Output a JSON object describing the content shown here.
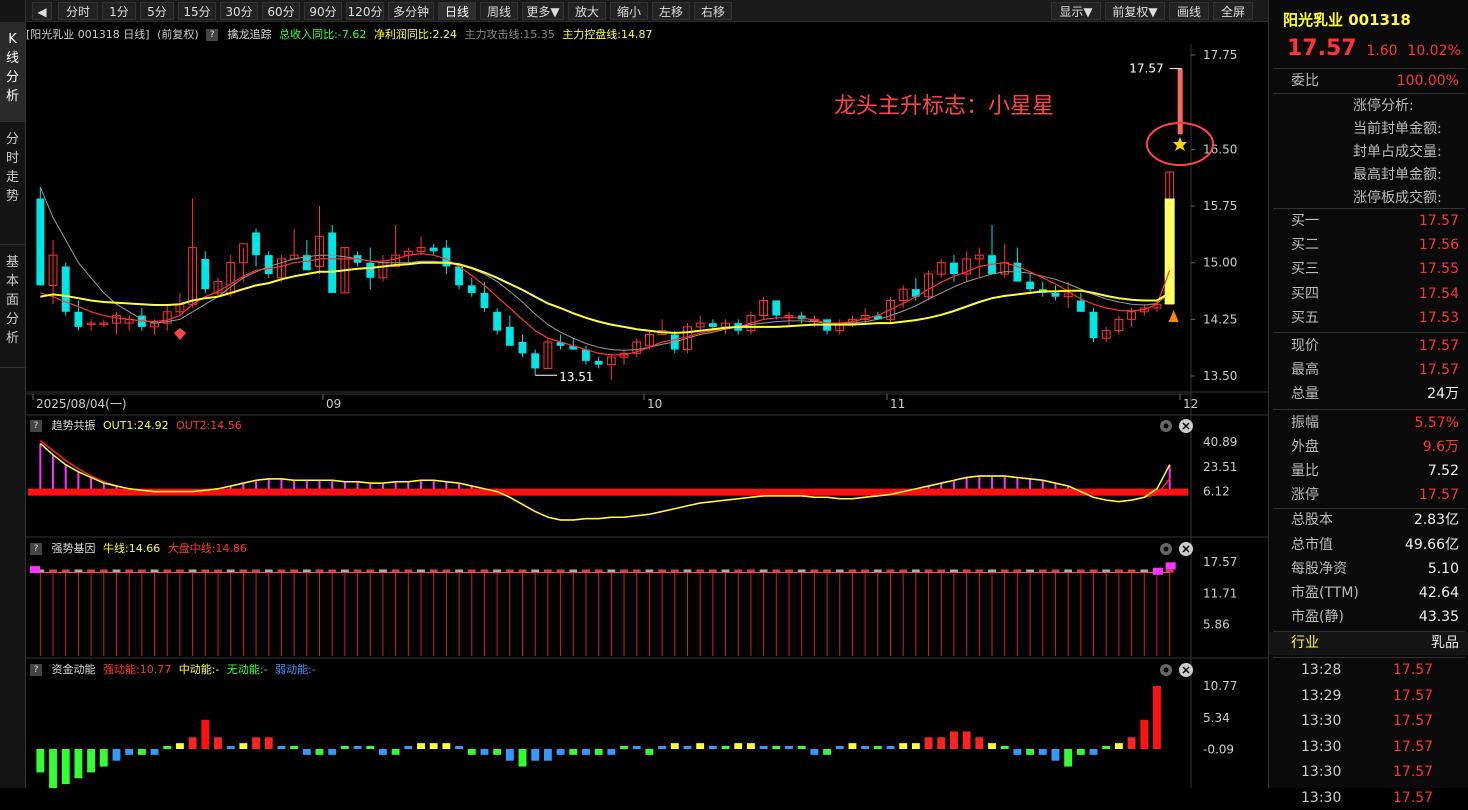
{
  "toolbar": {
    "items": [
      "分时",
      "1分",
      "5分",
      "15分",
      "30分",
      "60分",
      "90分",
      "120分",
      "多分钟",
      "日线",
      "周线",
      "更多▼",
      "放大",
      "缩小",
      "左移",
      "右移"
    ],
    "active": "日线",
    "right": [
      "显示▼",
      "前复权▼",
      "画线",
      "全屏"
    ]
  },
  "leftnav": [
    {
      "label": [
        "K",
        "线",
        "分",
        "析"
      ],
      "active": true
    },
    {
      "label": [
        "分",
        "时",
        "走",
        "势"
      ],
      "active": false
    },
    {
      "label": [
        "基",
        "本",
        "面",
        "分",
        "析"
      ],
      "active": false
    }
  ],
  "main_panel": {
    "stock": "[阳光乳业 001318 日线]",
    "adj": "(前复权)",
    "indicator": "擒龙追踪",
    "f1": "总收入同比:-7.62",
    "f2": "净利润同比:2.24",
    "f3": "主力攻击线:15.35",
    "f4": "主力控盘线:14.87",
    "annotation": "龙头主升标志：小星星",
    "high_label": "17.57",
    "low_label": "13.51",
    "yticks": [
      "17.75",
      "16.50",
      "15.75",
      "15.00",
      "14.25",
      "13.50"
    ],
    "xticks": [
      "2025/08/04(一)",
      "09",
      "10",
      "11",
      "12"
    ]
  },
  "panel2": {
    "name": "趋势共振",
    "l1": "OUT1:24.92",
    "l2": "OUT2:14.56",
    "yticks": [
      "40.89",
      "23.51",
      "6.12"
    ]
  },
  "panel3": {
    "name": "强势基因",
    "l1": "牛线:14.66",
    "l2": "大盘中线:14.86",
    "yticks": [
      "17.57",
      "11.71",
      "5.86"
    ]
  },
  "panel4": {
    "name": "资金动能",
    "l1": "强动能:10.77",
    "l2": "中动能:-",
    "l3": "无动能:-",
    "l4": "弱动能:-",
    "yticks": [
      "10.77",
      "5.34",
      "-0.09"
    ]
  },
  "quote": {
    "name": "阳光乳业",
    "code": "001318",
    "price": "17.57",
    "change": "1.60",
    "pct": "10.02%",
    "weibi_label": "委比",
    "weibi": "100.00%",
    "limit_title": "涨停分析:",
    "limit_rows": [
      "当前封单金额:",
      "封单占成交量:",
      "最高封单金额:",
      "涨停板成交额:"
    ],
    "buy": [
      {
        "k": "买一",
        "v": "17.57"
      },
      {
        "k": "买二",
        "v": "17.56"
      },
      {
        "k": "买三",
        "v": "17.55"
      },
      {
        "k": "买四",
        "v": "17.54"
      },
      {
        "k": "买五",
        "v": "17.53"
      }
    ],
    "stats1": [
      {
        "k": "现价",
        "v": "17.57",
        "c": "red"
      },
      {
        "k": "最高",
        "v": "17.57",
        "c": "red"
      },
      {
        "k": "总量",
        "v": "24万",
        "c": "white"
      }
    ],
    "stats2": [
      {
        "k": "振幅",
        "v": "5.57%",
        "c": "red"
      },
      {
        "k": "外盘",
        "v": "9.6万",
        "c": "red"
      },
      {
        "k": "量比",
        "v": "7.52",
        "c": "white"
      },
      {
        "k": "涨停",
        "v": "17.57",
        "c": "red"
      }
    ],
    "stats3": [
      {
        "k": "总股本",
        "v": "2.83亿"
      },
      {
        "k": "总市值",
        "v": "49.66亿"
      },
      {
        "k": "每股净资",
        "v": "5.10"
      },
      {
        "k": "市盈(TTM)",
        "v": "42.64"
      },
      {
        "k": "市盈(静)",
        "v": "43.35"
      }
    ],
    "industry_label": "行业",
    "industry": "乳品",
    "ticks": [
      {
        "t": "13:28",
        "p": "17.57"
      },
      {
        "t": "13:29",
        "p": "17.57"
      },
      {
        "t": "13:30",
        "p": "17.57"
      },
      {
        "t": "13:30",
        "p": "17.57"
      },
      {
        "t": "13:30",
        "p": "17.57"
      },
      {
        "t": "13:30",
        "p": "17.57"
      }
    ]
  },
  "colors": {
    "up": "#ff3333",
    "down": "#00e5e5",
    "ma1": "#ffff33",
    "ma2": "#ff3333",
    "ma3": "#999999",
    "magenta": "#ff33ff",
    "blue": "#3399ff",
    "green": "#33ff33"
  },
  "chart_data": {
    "type": "candlestick",
    "ohlc": [
      [
        15.85,
        16.0,
        14.7,
        14.7
      ],
      [
        14.7,
        15.3,
        14.45,
        15.1
      ],
      [
        14.95,
        15.0,
        14.3,
        14.35
      ],
      [
        14.35,
        14.5,
        14.1,
        14.15
      ],
      [
        14.2,
        14.25,
        14.1,
        14.2
      ],
      [
        14.2,
        14.25,
        14.15,
        14.2
      ],
      [
        14.2,
        14.35,
        14.05,
        14.3
      ],
      [
        14.2,
        14.3,
        14.1,
        14.25
      ],
      [
        14.3,
        14.4,
        14.1,
        14.15
      ],
      [
        14.15,
        14.25,
        14.05,
        14.2
      ],
      [
        14.2,
        14.45,
        14.1,
        14.35
      ],
      [
        14.35,
        14.6,
        14.3,
        14.45
      ],
      [
        14.45,
        15.85,
        14.4,
        15.2
      ],
      [
        15.05,
        15.15,
        14.6,
        14.65
      ],
      [
        14.6,
        14.8,
        14.55,
        14.75
      ],
      [
        14.6,
        15.1,
        14.55,
        15.0
      ],
      [
        15.0,
        15.2,
        14.75,
        15.25
      ],
      [
        15.4,
        15.45,
        14.95,
        15.1
      ],
      [
        15.1,
        15.15,
        14.8,
        14.85
      ],
      [
        14.8,
        15.1,
        14.75,
        15.05
      ],
      [
        15.05,
        15.45,
        15.05,
        15.1
      ],
      [
        15.1,
        15.3,
        14.9,
        14.9
      ],
      [
        14.95,
        15.75,
        14.85,
        15.35
      ],
      [
        15.4,
        15.5,
        14.8,
        14.6
      ],
      [
        14.6,
        15.2,
        14.6,
        15.2
      ],
      [
        15.1,
        15.15,
        14.95,
        15.0
      ],
      [
        15.0,
        15.2,
        14.65,
        14.8
      ],
      [
        14.8,
        15.1,
        14.75,
        15.0
      ],
      [
        14.95,
        15.5,
        14.95,
        15.1
      ],
      [
        15.1,
        15.2,
        15.0,
        15.15
      ],
      [
        15.15,
        15.35,
        15.1,
        15.2
      ],
      [
        15.2,
        15.25,
        15.1,
        15.15
      ],
      [
        15.2,
        15.3,
        14.85,
        14.95
      ],
      [
        14.95,
        15.0,
        14.65,
        14.7
      ],
      [
        14.7,
        14.8,
        14.55,
        14.6
      ],
      [
        14.6,
        14.75,
        14.35,
        14.4
      ],
      [
        14.35,
        14.4,
        14.05,
        14.1
      ],
      [
        14.15,
        14.3,
        14.0,
        13.9
      ],
      [
        13.95,
        14.05,
        13.75,
        13.8
      ],
      [
        13.8,
        13.85,
        13.51,
        13.6
      ],
      [
        13.6,
        14.0,
        13.6,
        13.95
      ],
      [
        13.95,
        14.05,
        13.85,
        13.9
      ],
      [
        13.9,
        14.0,
        13.85,
        13.85
      ],
      [
        13.85,
        13.9,
        13.65,
        13.7
      ],
      [
        13.7,
        13.75,
        13.6,
        13.65
      ],
      [
        13.65,
        13.8,
        13.45,
        13.75
      ],
      [
        13.75,
        13.85,
        13.65,
        13.8
      ],
      [
        13.8,
        14.0,
        13.75,
        13.95
      ],
      [
        13.9,
        14.1,
        13.85,
        14.05
      ],
      [
        14.05,
        14.25,
        14.05,
        14.1
      ],
      [
        14.05,
        14.1,
        13.8,
        13.85
      ],
      [
        13.85,
        14.2,
        13.8,
        14.15
      ],
      [
        14.15,
        14.3,
        14.1,
        14.2
      ],
      [
        14.2,
        14.25,
        14.1,
        14.15
      ],
      [
        14.15,
        14.25,
        14.05,
        14.2
      ],
      [
        14.2,
        14.25,
        14.05,
        14.1
      ],
      [
        14.1,
        14.35,
        14.05,
        14.3
      ],
      [
        14.3,
        14.55,
        14.25,
        14.5
      ],
      [
        14.5,
        14.5,
        14.25,
        14.3
      ],
      [
        14.3,
        14.35,
        14.15,
        14.3
      ],
      [
        14.3,
        14.35,
        14.2,
        14.25
      ],
      [
        14.25,
        14.3,
        14.15,
        14.25
      ],
      [
        14.25,
        14.25,
        14.05,
        14.1
      ],
      [
        14.1,
        14.25,
        14.05,
        14.2
      ],
      [
        14.2,
        14.3,
        14.15,
        14.25
      ],
      [
        14.25,
        14.4,
        14.2,
        14.3
      ],
      [
        14.3,
        14.35,
        14.25,
        14.25
      ],
      [
        14.25,
        14.55,
        14.2,
        14.5
      ],
      [
        14.5,
        14.7,
        14.4,
        14.65
      ],
      [
        14.65,
        14.8,
        14.5,
        14.55
      ],
      [
        14.55,
        14.9,
        14.5,
        14.85
      ],
      [
        14.85,
        15.05,
        14.8,
        15.0
      ],
      [
        15.0,
        15.1,
        14.75,
        14.85
      ],
      [
        14.85,
        15.15,
        14.75,
        15.05
      ],
      [
        15.05,
        15.2,
        14.8,
        15.1
      ],
      [
        15.1,
        15.5,
        14.85,
        14.85
      ],
      [
        14.85,
        15.25,
        14.8,
        15.0
      ],
      [
        15.0,
        15.2,
        14.8,
        14.75
      ],
      [
        14.75,
        14.85,
        14.6,
        14.65
      ],
      [
        14.65,
        14.75,
        14.55,
        14.6
      ],
      [
        14.6,
        14.7,
        14.5,
        14.55
      ],
      [
        14.55,
        14.75,
        14.4,
        14.6
      ],
      [
        14.5,
        14.6,
        14.35,
        14.35
      ],
      [
        14.35,
        14.4,
        13.95,
        14.0
      ],
      [
        14.0,
        14.15,
        13.95,
        14.1
      ],
      [
        14.1,
        14.3,
        14.05,
        14.25
      ],
      [
        14.25,
        14.4,
        14.15,
        14.35
      ],
      [
        14.35,
        14.45,
        14.3,
        14.4
      ],
      [
        14.4,
        14.5,
        14.35,
        14.45
      ],
      [
        14.45,
        16.2,
        14.45,
        16.2
      ]
    ],
    "ma_yellow": [
      14.55,
      14.58,
      14.56,
      14.53,
      14.5,
      14.48,
      14.47,
      14.46,
      14.45,
      14.44,
      14.44,
      14.45,
      14.5,
      14.53,
      14.55,
      14.6,
      14.65,
      14.7,
      14.73,
      14.78,
      14.82,
      14.85,
      14.88,
      14.88,
      14.9,
      14.92,
      14.93,
      14.95,
      14.97,
      14.98,
      15.0,
      15.0,
      15.0,
      14.98,
      14.93,
      14.87,
      14.8,
      14.72,
      14.64,
      14.55,
      14.46,
      14.4,
      14.33,
      14.27,
      14.22,
      14.18,
      14.15,
      14.12,
      14.1,
      14.08,
      14.07,
      14.08,
      14.1,
      14.12,
      14.14,
      14.15,
      14.15,
      14.15,
      14.15,
      14.16,
      14.17,
      14.18,
      14.18,
      14.18,
      14.18,
      14.19,
      14.2,
      14.2,
      14.22,
      14.24,
      14.27,
      14.31,
      14.36,
      14.42,
      14.48,
      14.53,
      14.56,
      14.58,
      14.6,
      14.62,
      14.62,
      14.63,
      14.63,
      14.6,
      14.56,
      14.53,
      14.51,
      14.5,
      14.5,
      14.6
    ],
    "ma_red": [
      14.6,
      14.55,
      14.48,
      14.42,
      14.35,
      14.3,
      14.27,
      14.25,
      14.23,
      14.22,
      14.24,
      14.3,
      14.45,
      14.55,
      14.62,
      14.72,
      14.82,
      14.9,
      14.92,
      14.95,
      15.0,
      15.02,
      15.05,
      15.05,
      15.05,
      15.05,
      15.02,
      15.02,
      15.05,
      15.1,
      15.12,
      15.1,
      15.05,
      14.95,
      14.83,
      14.7,
      14.55,
      14.4,
      14.25,
      14.1,
      14.0,
      13.95,
      13.9,
      13.85,
      13.8,
      13.78,
      13.78,
      13.82,
      13.88,
      13.95,
      13.98,
      14.02,
      14.07,
      14.1,
      14.13,
      14.15,
      14.2,
      14.25,
      14.27,
      14.27,
      14.27,
      14.24,
      14.2,
      14.2,
      14.22,
      14.26,
      14.3,
      14.38,
      14.46,
      14.55,
      14.65,
      14.74,
      14.82,
      14.88,
      14.95,
      14.98,
      15.0,
      14.95,
      14.88,
      14.8,
      14.72,
      14.62,
      14.52,
      14.45,
      14.4,
      14.37,
      14.36,
      14.38,
      14.45,
      14.9
    ],
    "ma_gray": [
      16.0,
      15.6,
      15.3,
      15.0,
      14.8,
      14.6,
      14.45,
      14.35,
      14.25,
      14.2,
      14.22,
      14.25,
      14.35,
      14.45,
      14.55,
      14.68,
      14.8,
      14.88,
      14.95,
      15.0,
      15.05,
      15.08,
      15.1,
      15.1,
      15.08,
      15.05,
      15.02,
      15.0,
      15.0,
      15.0,
      15.02,
      15.02,
      15.0,
      14.97,
      14.92,
      14.85,
      14.75,
      14.62,
      14.48,
      14.32,
      14.18,
      14.08,
      14.0,
      13.93,
      13.88,
      13.85,
      13.84,
      13.85,
      13.88,
      13.92,
      13.95,
      14.0,
      14.05,
      14.08,
      14.12,
      14.15,
      14.18,
      14.2,
      14.22,
      14.23,
      14.23,
      14.22,
      14.2,
      14.2,
      14.2,
      14.22,
      14.25,
      14.3,
      14.36,
      14.43,
      14.52,
      14.6,
      14.68,
      14.75,
      14.8,
      14.85,
      14.88,
      14.88,
      14.86,
      14.82,
      14.78,
      14.72,
      14.65,
      14.58,
      14.52,
      14.48,
      14.45,
      14.44,
      14.46,
      14.6
    ],
    "panel2": {
      "out1": [
        40,
        32,
        25,
        20,
        16,
        12,
        10,
        8,
        7,
        6,
        6,
        6,
        6,
        7,
        8,
        10,
        12,
        14,
        15,
        15,
        14,
        14,
        14,
        14,
        13,
        13,
        12,
        12,
        13,
        13,
        14,
        14,
        13,
        12,
        10,
        8,
        6,
        2,
        -3,
        -8,
        -12,
        -14,
        -14,
        -13,
        -13,
        -12,
        -12,
        -11,
        -10,
        -8,
        -6,
        -4,
        -2,
        -1,
        0,
        1,
        2,
        3,
        3,
        3,
        3,
        2,
        2,
        1,
        1,
        2,
        3,
        4,
        6,
        8,
        10,
        12,
        14,
        16,
        17,
        17,
        17,
        16,
        15,
        14,
        12,
        10,
        6,
        2,
        0,
        -1,
        0,
        2,
        8,
        25
      ],
      "out2": [
        42,
        35,
        28,
        22,
        17,
        13,
        10,
        8,
        7,
        6,
        6,
        6,
        6,
        7,
        8,
        10,
        12,
        14,
        15,
        15,
        14,
        14,
        14,
        14,
        13,
        13,
        12,
        12,
        13,
        13,
        14,
        14,
        13,
        12,
        10,
        8,
        6,
        2,
        -3,
        -8,
        -12,
        -14,
        -14,
        -13,
        -13,
        -12,
        -12,
        -11,
        -10,
        -8,
        -6,
        -4,
        -2,
        -1,
        0,
        1,
        2,
        3,
        3,
        3,
        3,
        2,
        2,
        1,
        1,
        2,
        3,
        4,
        6,
        8,
        10,
        12,
        14,
        16,
        17,
        17,
        17,
        16,
        15,
        14,
        12,
        10,
        6,
        2,
        0,
        -1,
        0,
        2,
        4,
        15
      ]
    },
    "panel4": {
      "bars": [
        -4,
        -8,
        -6,
        -5,
        -4,
        -3,
        -2,
        -1,
        -1,
        -1,
        0,
        1,
        2,
        5,
        2,
        0,
        1,
        2,
        2,
        0,
        0,
        -1,
        -1,
        -1,
        0,
        0,
        0,
        -1,
        -1,
        0,
        1,
        1,
        1,
        0,
        -1,
        -1,
        -1,
        -2,
        -3,
        -2,
        -2,
        -1,
        -1,
        -1,
        -1,
        -1,
        0,
        0,
        -1,
        0,
        1,
        0,
        1,
        0,
        0,
        1,
        1,
        0,
        0,
        0,
        0,
        -1,
        -1,
        0,
        1,
        0,
        0,
        0,
        1,
        1,
        2,
        2,
        3,
        3,
        2,
        1,
        0,
        -1,
        -1,
        -1,
        -2,
        -3,
        -1,
        -1,
        0,
        1,
        2,
        5,
        10.77
      ]
    }
  }
}
